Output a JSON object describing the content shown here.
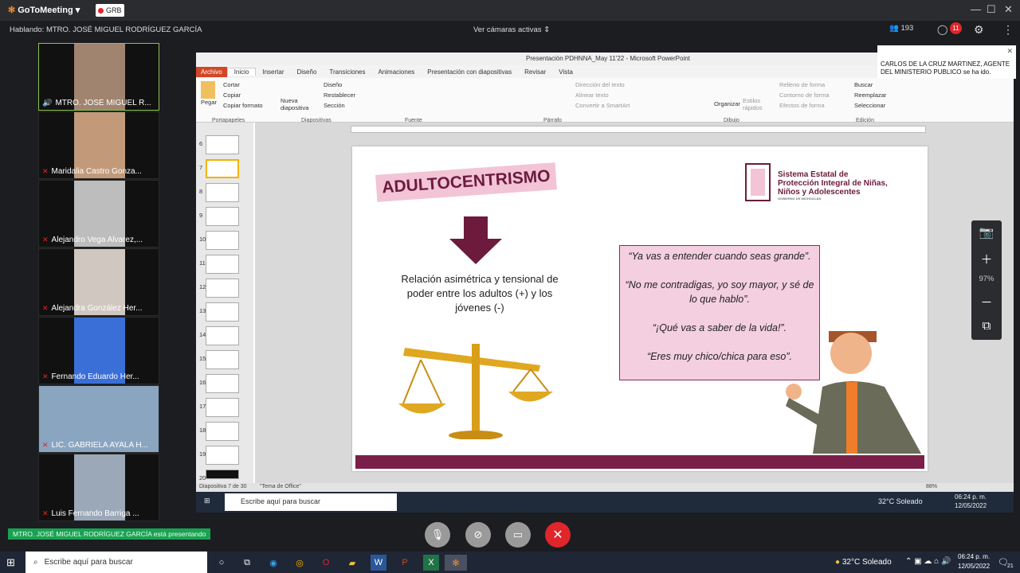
{
  "app": {
    "name": "GoToMeeting",
    "rec_label": "GRB"
  },
  "window_controls": {
    "minimize": "—",
    "maximize": "☐",
    "close": "✕"
  },
  "header": {
    "speaking": "Hablando: MTRO. JOSÉ MIGUEL RODRÍGUEZ GARCÍA",
    "cameras": "Ver cámaras activas",
    "participants_count": "193",
    "chat_badge": "11"
  },
  "participants": [
    {
      "name": "MTRO. JOSÉ MIGUEL R..."
    },
    {
      "name": "Maridalia Castro Gonza..."
    },
    {
      "name": "Alejandro Vega Alvarez,..."
    },
    {
      "name": "Alejandra González Her..."
    },
    {
      "name": "Fernando Eduardo Her..."
    },
    {
      "name": "LIC. GABRIELA AYALA H..."
    },
    {
      "name": "Luis Fernando Barriga ..."
    }
  ],
  "ppt": {
    "title": "Presentación PDHNNA_May 11'22 - Microsoft PowerPoint",
    "tabs": [
      "Archivo",
      "Inicio",
      "Insertar",
      "Diseño",
      "Transiciones",
      "Animaciones",
      "Presentación con diapositivas",
      "Revisar",
      "Vista"
    ],
    "ribbon": {
      "pegar": "Pegar",
      "cortar": "Cortar",
      "copiar": "Copiar",
      "copiar_formato": "Copiar formato",
      "nueva_diapositiva": "Nueva diapositiva",
      "diseno": "Diseño",
      "restablecer": "Restablecer",
      "seccion": "Sección",
      "direccion_texto": "Dirección del texto",
      "alinear_texto": "Alinear texto",
      "convertir_smartart": "Convertir a SmartArt",
      "organizar": "Organizar",
      "estilos_rapidos": "Estilos rápidos",
      "relleno_forma": "Relleno de forma",
      "contorno_forma": "Contorno de forma",
      "efectos_forma": "Efectos de forma",
      "buscar": "Buscar",
      "reemplazar": "Reemplazar",
      "seleccionar": "Seleccionar",
      "groups": [
        "Portapapeles",
        "Diapositivas",
        "Fuente",
        "Párrafo",
        "Dibujo",
        "Edición"
      ]
    },
    "thumb_numbers": [
      "6",
      "7",
      "8",
      "9",
      "10",
      "11",
      "12",
      "13",
      "14",
      "15",
      "16",
      "17",
      "18",
      "19",
      "20"
    ],
    "status": {
      "slide": "Diapositiva 7 de 30",
      "theme": "\"Tema de Office\"",
      "zoom": "88%"
    },
    "inner_taskbar": {
      "search": "Escribe aquí para buscar",
      "weather": "32°C  Soleado",
      "time": "06:24 p. m.",
      "date": "12/05/2022"
    }
  },
  "slide": {
    "title": "ADULTOCENTRISMO",
    "relation": "Relación asimétrica y tensional de poder entre los adultos (+) y los jóvenes (-)",
    "quotes": [
      "“Ya vas a entender cuando seas grande”.",
      "“No me contradigas, yo soy mayor, y sé de lo que hablo”.",
      "“¡Qué vas a saber de la vida!”.",
      "“Eres muy chico/chica para eso”."
    ],
    "org_line1": "Sistema Estatal de",
    "org_line2": "Protección Integral de Niñas,",
    "org_line3": "Niños y Adolescentes",
    "org_line4": "GOBIERNO DE MICHOACÁN",
    "accent_color": "#6d1b3d",
    "pink_color": "#f4cfe0"
  },
  "zoom_panel": {
    "value": "97%"
  },
  "notification": {
    "text": "CARLOS DE LA CRUZ MARTINEZ, AGENTE DEL MINISTERIO PUBLICO se ha ido."
  },
  "presenting": "MTRO. JOSÉ MIGUEL RODRÍGUEZ GARCÍA está presentando",
  "taskbar": {
    "search": "Escribe aquí para buscar",
    "weather": "32°C  Soleado",
    "time": "06:24 p. m.",
    "date": "12/05/2022",
    "notif_count": "21"
  }
}
